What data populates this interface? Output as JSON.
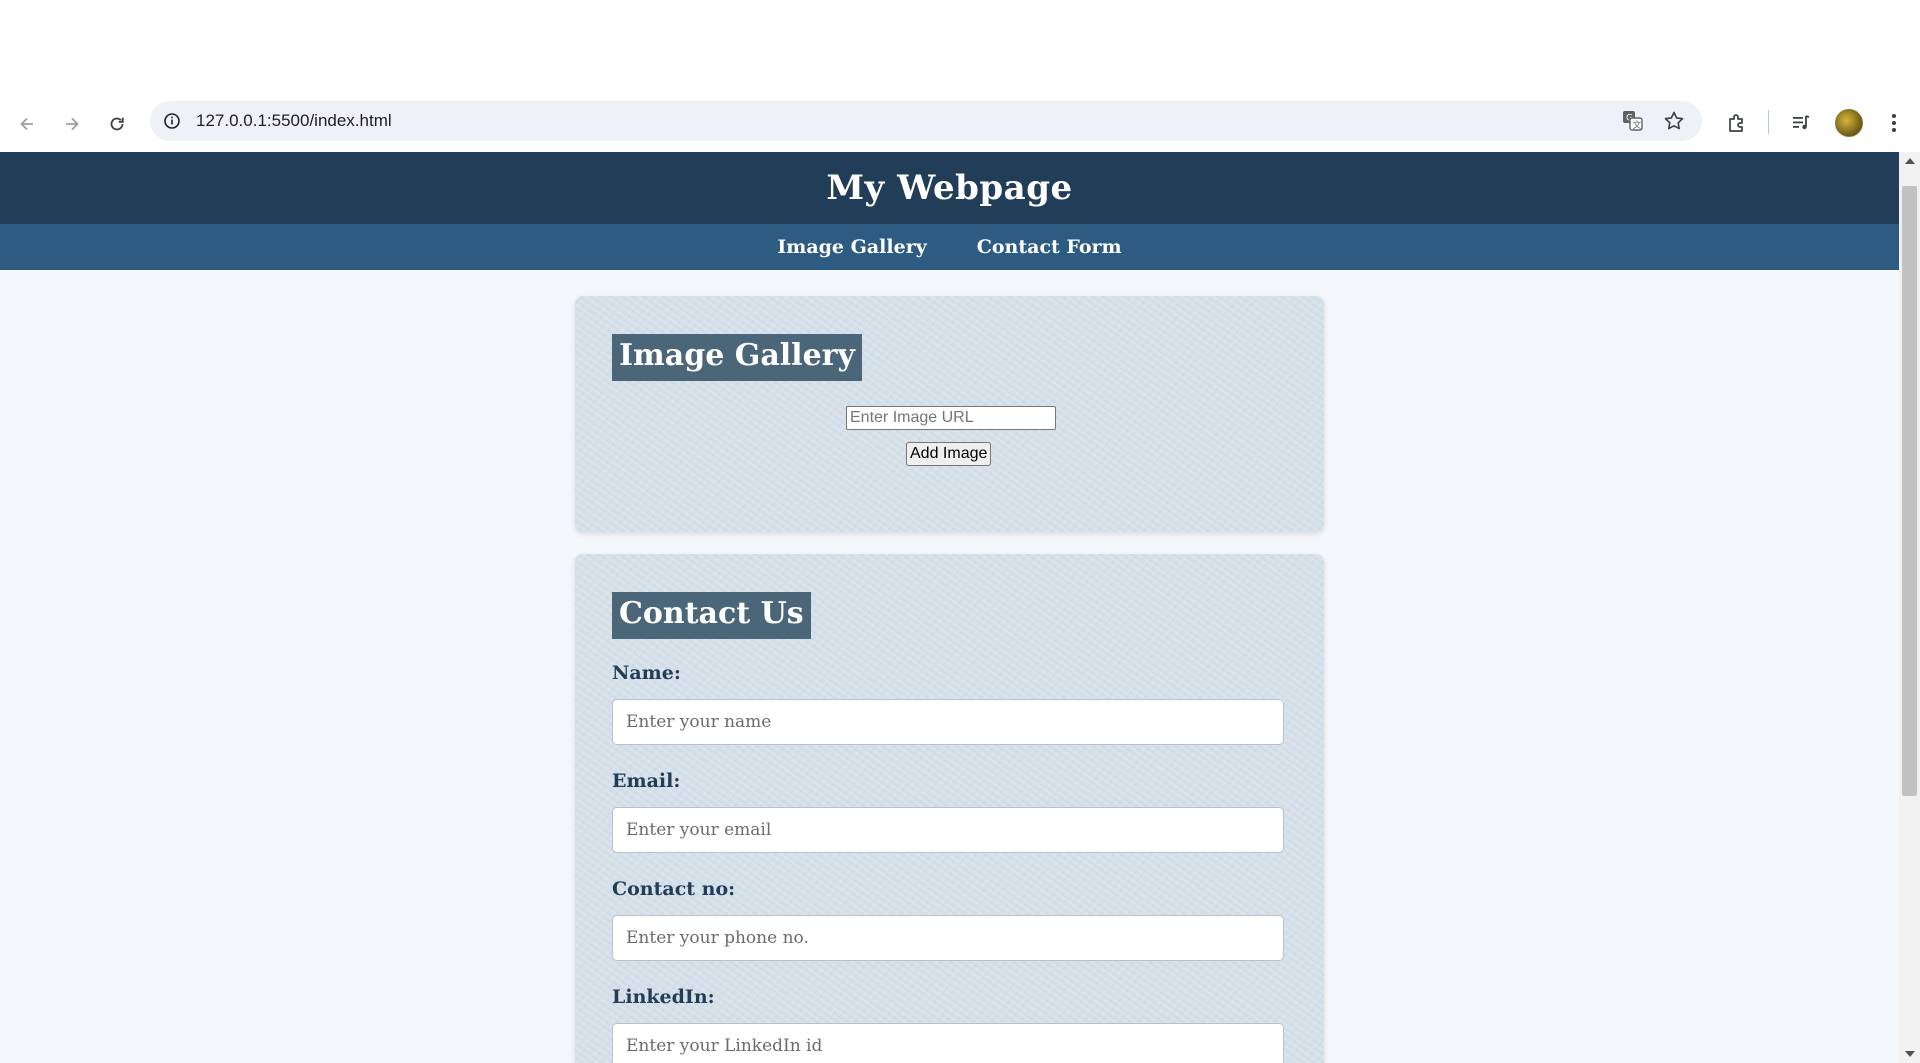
{
  "browser": {
    "url": "127.0.0.1:5500/index.html",
    "icons": [
      "back-icon",
      "forward-icon",
      "reload-icon",
      "site-info-icon",
      "translate-icon",
      "bookmark-star-icon",
      "extensions-icon",
      "media-control-icon",
      "profile-avatar",
      "more-menu-icon"
    ]
  },
  "page": {
    "title": "My Webpage",
    "nav": {
      "gallery_link": "Image Gallery",
      "contact_link": "Contact Form"
    },
    "gallery": {
      "heading": "Image Gallery",
      "url_placeholder": "Enter Image URL",
      "add_button": "Add Image"
    },
    "contact": {
      "heading": "Contact Us",
      "name_label": "Name:",
      "name_placeholder": "Enter your name",
      "email_label": "Email:",
      "email_placeholder": "Enter your email",
      "phone_label": "Contact no:",
      "phone_placeholder": "Enter your phone no.",
      "linkedin_label": "LinkedIn:",
      "linkedin_placeholder": "Enter your LinkedIn id"
    }
  },
  "colors": {
    "header_bg": "#213d58",
    "nav_bg": "#2e5b82",
    "heading_bg": "#4b6678",
    "card_bg": "#d5e0ea",
    "page_bg": "#f4f7fb"
  }
}
